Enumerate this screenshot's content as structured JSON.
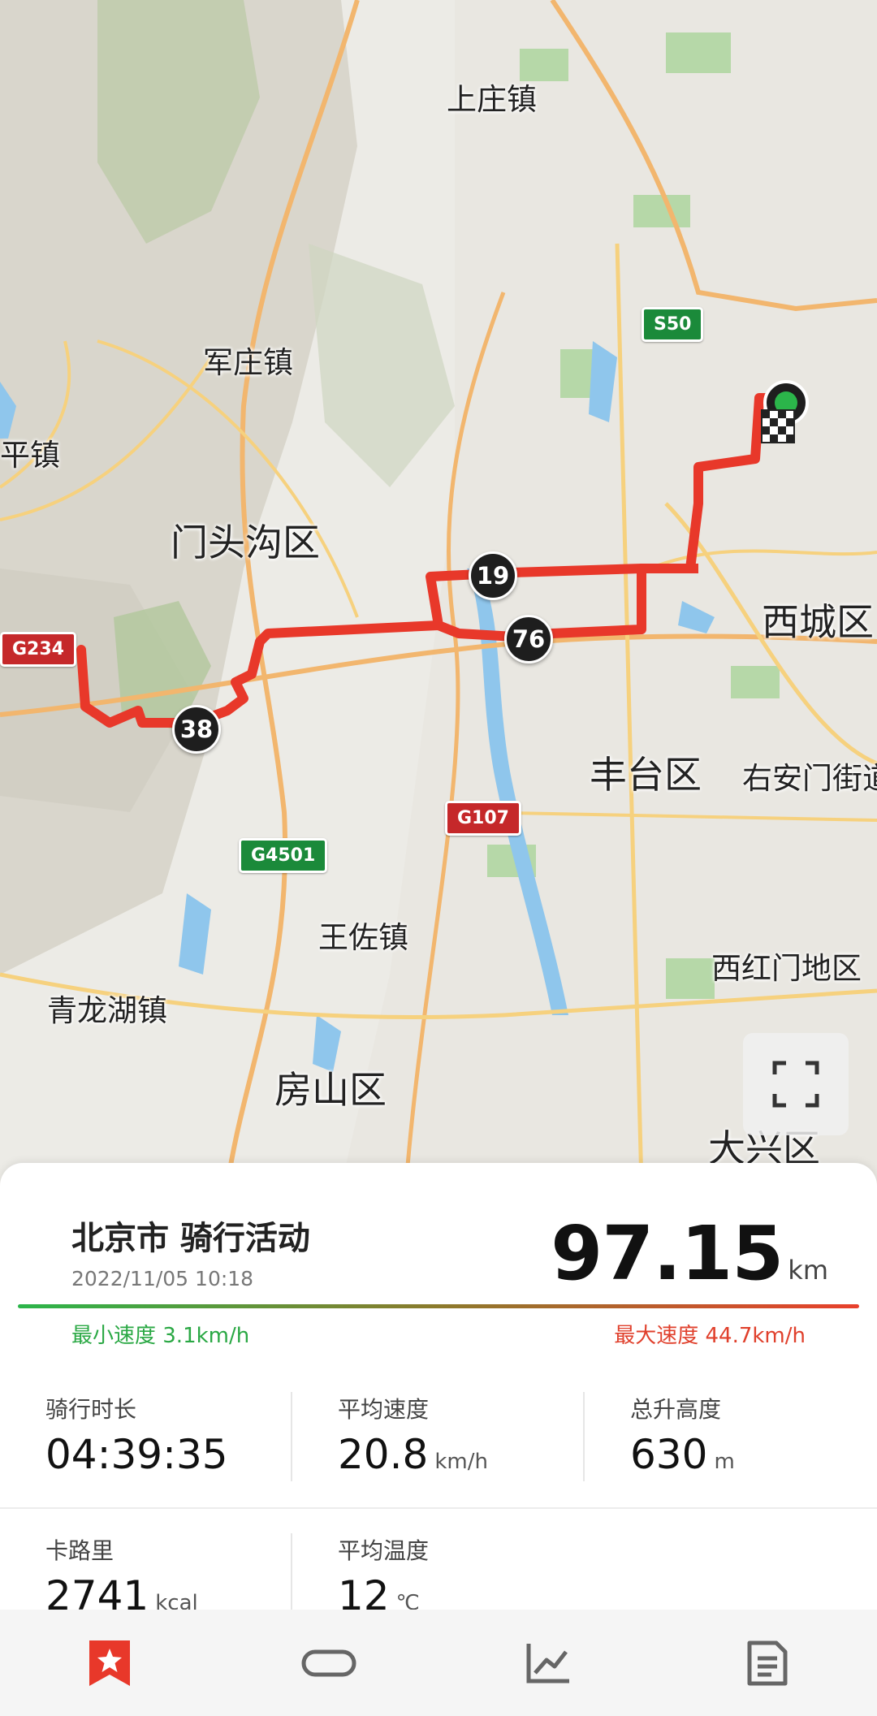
{
  "map": {
    "place_labels": [
      "上庄镇",
      "军庄镇",
      "平镇",
      "门头沟区",
      "西城区",
      "丰台区",
      "右安门街道",
      "西红门地区",
      "王佐镇",
      "青龙湖镇",
      "房山区",
      "大兴区"
    ],
    "road_shields": [
      {
        "label": "S50",
        "color": "#1b8a3a"
      },
      {
        "label": "G234",
        "color": "#c5282a"
      },
      {
        "label": "G107",
        "color": "#c5282a"
      },
      {
        "label": "G4501",
        "color": "#1b8a3a"
      }
    ],
    "km_markers": [
      "19",
      "76",
      "38"
    ],
    "route_color": "#e8382a",
    "expand_icon": "fullscreen-icon"
  },
  "activity": {
    "title": "北京市 骑行活动",
    "datetime": "2022/11/05 10:18",
    "distance_value": "97.15",
    "distance_unit": "km",
    "min_speed": "最小速度 3.1km/h",
    "max_speed": "最大速度 44.7km/h"
  },
  "stats": [
    {
      "label": "骑行时长",
      "value": "04:39:35",
      "unit": ""
    },
    {
      "label": "平均速度",
      "value": "20.8",
      "unit": "km/h"
    },
    {
      "label": "总升高度",
      "value": "630",
      "unit": "m"
    },
    {
      "label": "卡路里",
      "value": "2741",
      "unit": "kcal"
    },
    {
      "label": "平均温度",
      "value": "12",
      "unit": "℃"
    }
  ],
  "tabbar": {
    "items": [
      {
        "icon": "bookmark-star-icon",
        "active": true
      },
      {
        "icon": "link-icon",
        "active": false
      },
      {
        "icon": "chart-icon",
        "active": false
      },
      {
        "icon": "document-icon",
        "active": false
      }
    ],
    "active_color": "#e8382a"
  }
}
